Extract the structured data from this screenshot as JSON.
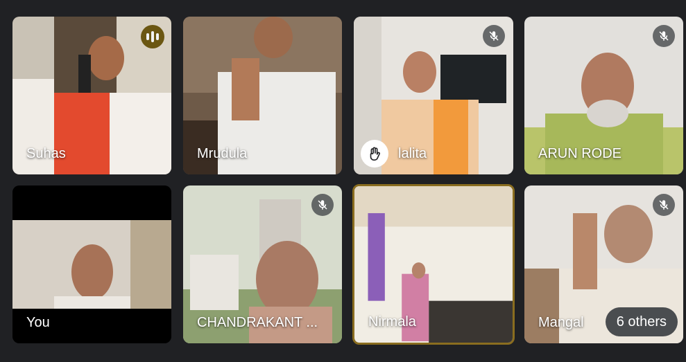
{
  "participants": [
    {
      "name": "Suhas",
      "state": "speaking"
    },
    {
      "name": "Mrudula",
      "state": "none"
    },
    {
      "name": "lalita",
      "state": "muted",
      "hand_raised": true
    },
    {
      "name": "ARUN RODE",
      "state": "muted"
    },
    {
      "name": "You",
      "state": "none"
    },
    {
      "name": "CHANDRAKANT ...",
      "state": "muted"
    },
    {
      "name": "Nirmala",
      "state": "none",
      "highlighted": true
    },
    {
      "name": "Mangal",
      "state": "muted"
    }
  ],
  "overflow": {
    "label": "6 others"
  },
  "icons": {
    "muted": "mic-off-icon",
    "speaking": "audio-level-icon",
    "hand": "raised-hand-icon",
    "more": "more-options-icon"
  },
  "colors": {
    "background": "#202124",
    "speaking_badge": "#6b5712",
    "highlight_border": "#8a6d1f"
  }
}
